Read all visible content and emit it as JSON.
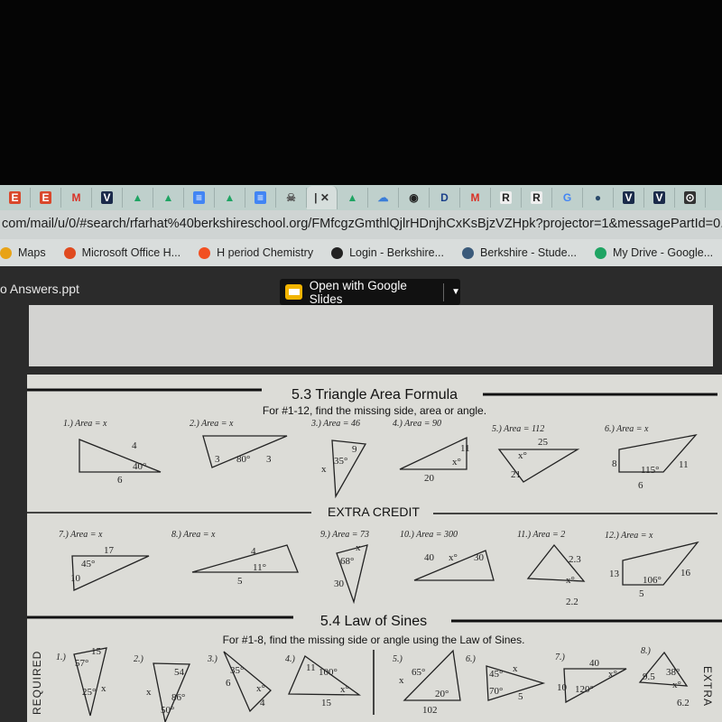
{
  "browser": {
    "tabs": [
      {
        "glyph": "E",
        "color": "#d9482b",
        "fg": "#fff"
      },
      {
        "glyph": "E",
        "color": "#d9482b",
        "fg": "#fff"
      },
      {
        "glyph": "M",
        "color": "transparent",
        "fg": "#d93025"
      },
      {
        "glyph": "V",
        "color": "#1a2a4a",
        "fg": "#fff"
      },
      {
        "glyph": "▲",
        "color": "transparent",
        "fg": "#1fa463"
      },
      {
        "glyph": "▲",
        "color": "transparent",
        "fg": "#1fa463"
      },
      {
        "glyph": "≡",
        "color": "#4285f4",
        "fg": "#fff"
      },
      {
        "glyph": "▲",
        "color": "transparent",
        "fg": "#1fa463"
      },
      {
        "glyph": "≡",
        "color": "#4285f4",
        "fg": "#fff"
      },
      {
        "glyph": "☠",
        "color": "transparent",
        "fg": "#555"
      },
      {
        "glyph": "| ✕",
        "color": "transparent",
        "fg": "#333",
        "active": true
      },
      {
        "glyph": "▲",
        "color": "transparent",
        "fg": "#1fa463"
      },
      {
        "glyph": "☁",
        "color": "transparent",
        "fg": "#3b7dd8"
      },
      {
        "glyph": "◉",
        "color": "transparent",
        "fg": "#222"
      },
      {
        "glyph": "D",
        "color": "transparent",
        "fg": "#1a3f8a"
      },
      {
        "glyph": "M",
        "color": "transparent",
        "fg": "#d93025"
      },
      {
        "glyph": "R",
        "color": "#eee",
        "fg": "#222"
      },
      {
        "glyph": "R",
        "color": "#eee",
        "fg": "#222"
      },
      {
        "glyph": "G",
        "color": "transparent",
        "fg": "#4285f4"
      },
      {
        "glyph": "●",
        "color": "transparent",
        "fg": "#2a4a6a"
      },
      {
        "glyph": "V",
        "color": "#1a2a4a",
        "fg": "#fff"
      },
      {
        "glyph": "V",
        "color": "#1a2a4a",
        "fg": "#fff"
      },
      {
        "glyph": "⊙",
        "color": "#333",
        "fg": "#fff"
      }
    ],
    "url": "com/mail/u/0/#search/rfarhat%40berkshireschool.org/FMfcgzGmthlQjlrHDnjhCxKsBjzVZHpk?projector=1&messagePartId=0.1",
    "bookmarks": [
      {
        "label": "Maps",
        "icon": "map-pin-icon",
        "color": "#e8a317"
      },
      {
        "label": "Microsoft Office H...",
        "icon": "office-icon",
        "color": "#e04a1f"
      },
      {
        "label": "H period Chemistry",
        "icon": "windows-grid-icon",
        "color": "#f25022"
      },
      {
        "label": "Login - Berkshire...",
        "icon": "globe-icon",
        "color": "#222"
      },
      {
        "label": "Berkshire - Stude...",
        "icon": "circle-logo-icon",
        "color": "#3a5a7a"
      },
      {
        "label": "My Drive - Google...",
        "icon": "google-drive-icon",
        "color": "#1fa463"
      }
    ]
  },
  "viewer": {
    "filename": "o Answers.ppt",
    "open_button": "Open with Google Slides"
  },
  "doc": {
    "s53": {
      "title": "5.3 Triangle Area Formula",
      "subtitle": "For #1-12, find the missing side, area or angle.",
      "extra_title": "EXTRA CREDIT",
      "problems": [
        {
          "label": "1.) Area = x",
          "marks": [
            "4",
            "40°",
            "6"
          ]
        },
        {
          "label": "2.) Area = x",
          "marks": [
            "3",
            "80°",
            "3"
          ]
        },
        {
          "label": "3.) Area = 46",
          "marks": [
            "9",
            "35°",
            "x"
          ]
        },
        {
          "label": "4.) Area = 90",
          "marks": [
            "11",
            "x°",
            "20"
          ]
        },
        {
          "label": "5.) Area = 112",
          "marks": [
            "25",
            "x°",
            "21"
          ]
        },
        {
          "label": "6.) Area = x",
          "marks": [
            "8",
            "115°",
            "11",
            "6"
          ]
        },
        {
          "label": "7.) Area = x",
          "marks": [
            "17",
            "45°",
            "10"
          ]
        },
        {
          "label": "8.) Area = x",
          "marks": [
            "4",
            "11°",
            "5"
          ]
        },
        {
          "label": "9.) Area = 73",
          "marks": [
            "x",
            "68°",
            "30"
          ]
        },
        {
          "label": "10.) Area = 300",
          "marks": [
            "40",
            "x°",
            "30"
          ]
        },
        {
          "label": "11.) Area = 2",
          "marks": [
            "2.3",
            "x°",
            "2.2"
          ]
        },
        {
          "label": "12.) Area = x",
          "marks": [
            "13",
            "106°",
            "16",
            "5"
          ]
        }
      ]
    },
    "s54": {
      "title": "5.4 Law of Sines",
      "subtitle": "For #1-8, find the missing side or angle using the Law of Sines.",
      "required_label": "REQUIRED",
      "extra_label": "EXTRA",
      "problems": [
        {
          "label": "1.)",
          "marks": [
            "15",
            "57°",
            "25°",
            "x"
          ]
        },
        {
          "label": "2.)",
          "marks": [
            "54",
            "x",
            "86°",
            "50°"
          ]
        },
        {
          "label": "3.)",
          "marks": [
            "35°",
            "6",
            "x°",
            "4"
          ]
        },
        {
          "label": "4.)",
          "marks": [
            "11",
            "100°",
            "x°",
            "15"
          ]
        },
        {
          "label": "5.)",
          "marks": [
            "x",
            "65°",
            "20°",
            "102"
          ]
        },
        {
          "label": "6.)",
          "marks": [
            "x",
            "45°",
            "70°",
            "5"
          ]
        },
        {
          "label": "7.)",
          "marks": [
            "40",
            "x°",
            "10",
            "120°"
          ]
        },
        {
          "label": "8.)",
          "marks": [
            "38°",
            "9.5",
            "x°",
            "6.2"
          ]
        }
      ]
    }
  }
}
